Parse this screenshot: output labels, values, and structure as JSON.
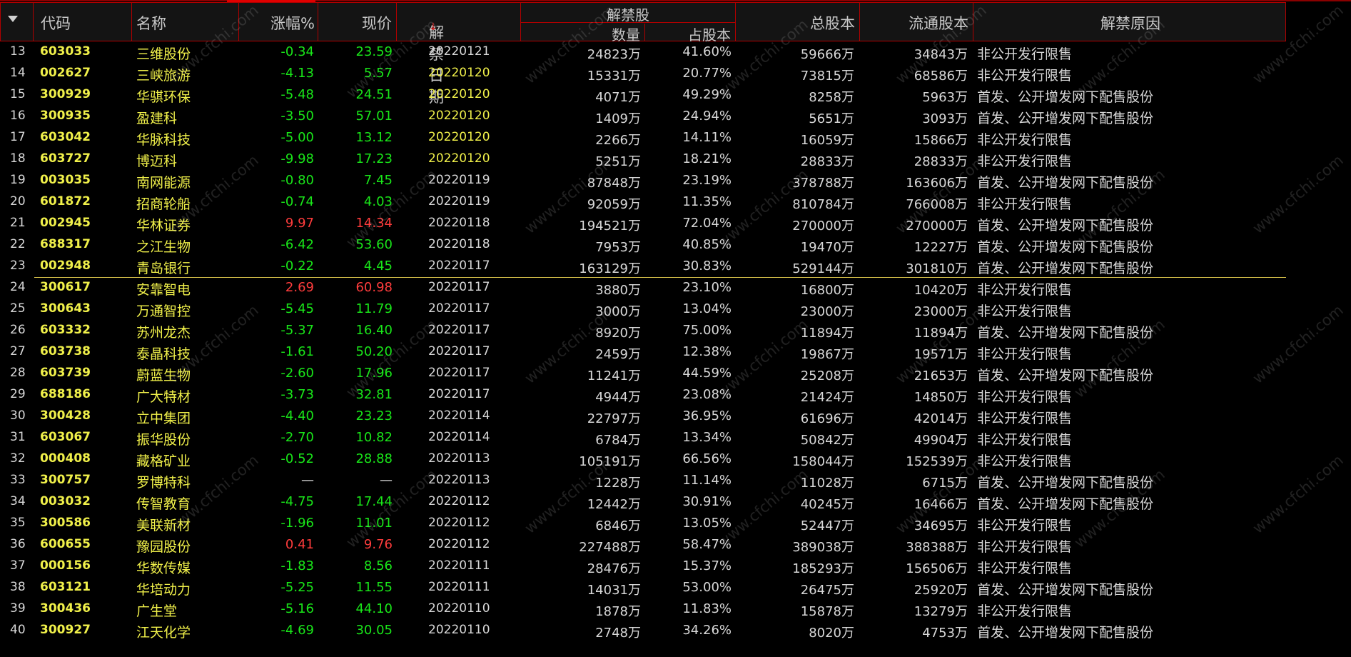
{
  "colors": {
    "up": "#ff3c3c",
    "down": "#19e619",
    "flat": "#d8d8d8",
    "yellow_date": "#f0f04a",
    "normal_date": "#d8d8d8"
  },
  "header": {
    "menu_icon": "triangle-down-icon",
    "code": "代码",
    "name": "名称",
    "change": "涨幅%",
    "price": "现价",
    "date": "解禁日期",
    "date_sort_icon": "sort-desc-arrow-icon",
    "date_sort_glyph": "↓",
    "unlock_group": "解禁股",
    "unlock_qty": "数量",
    "unlock_pct": "占股本",
    "total_shares": "总股本",
    "float_shares": "流通股本",
    "reason": "解禁原因"
  },
  "watermark": "www.cfchi.com",
  "rows": [
    {
      "idx": "13",
      "code": "603033",
      "name": "三维股份",
      "chg": "-0.34",
      "price": "23.59",
      "dir": "down",
      "date": "20220121",
      "date_hl": false,
      "qty": "24823万",
      "pct": "41.60%",
      "total": "59666万",
      "float": "34843万",
      "reason": "非公开发行限售"
    },
    {
      "idx": "14",
      "code": "002627",
      "name": "三峡旅游",
      "chg": "-4.13",
      "price": "5.57",
      "dir": "down",
      "date": "20220120",
      "date_hl": true,
      "qty": "15331万",
      "pct": "20.77%",
      "total": "73815万",
      "float": "68586万",
      "reason": "非公开发行限售"
    },
    {
      "idx": "15",
      "code": "300929",
      "name": "华骐环保",
      "chg": "-5.48",
      "price": "24.51",
      "dir": "down",
      "date": "20220120",
      "date_hl": true,
      "qty": "4071万",
      "pct": "49.29%",
      "total": "8258万",
      "float": "5963万",
      "reason": "首发、公开增发网下配售股份"
    },
    {
      "idx": "16",
      "code": "300935",
      "name": "盈建科",
      "chg": "-3.50",
      "price": "57.01",
      "dir": "down",
      "date": "20220120",
      "date_hl": true,
      "qty": "1409万",
      "pct": "24.94%",
      "total": "5651万",
      "float": "3093万",
      "reason": "首发、公开增发网下配售股份"
    },
    {
      "idx": "17",
      "code": "603042",
      "name": "华脉科技",
      "chg": "-5.00",
      "price": "13.12",
      "dir": "down",
      "date": "20220120",
      "date_hl": true,
      "qty": "2266万",
      "pct": "14.11%",
      "total": "16059万",
      "float": "15866万",
      "reason": "非公开发行限售"
    },
    {
      "idx": "18",
      "code": "603727",
      "name": "博迈科",
      "chg": "-9.98",
      "price": "17.23",
      "dir": "down",
      "date": "20220120",
      "date_hl": true,
      "qty": "5251万",
      "pct": "18.21%",
      "total": "28833万",
      "float": "28833万",
      "reason": "非公开发行限售"
    },
    {
      "idx": "19",
      "code": "003035",
      "name": "南网能源",
      "chg": "-0.80",
      "price": "7.45",
      "dir": "down",
      "date": "20220119",
      "date_hl": false,
      "qty": "87848万",
      "pct": "23.19%",
      "total": "378788万",
      "float": "163606万",
      "reason": "首发、公开增发网下配售股份"
    },
    {
      "idx": "20",
      "code": "601872",
      "name": "招商轮船",
      "chg": "-0.74",
      "price": "4.03",
      "dir": "down",
      "date": "20220119",
      "date_hl": false,
      "qty": "92059万",
      "pct": "11.35%",
      "total": "810784万",
      "float": "766008万",
      "reason": "非公开发行限售"
    },
    {
      "idx": "21",
      "code": "002945",
      "name": "华林证券",
      "chg": "9.97",
      "price": "14.34",
      "dir": "up",
      "date": "20220118",
      "date_hl": false,
      "qty": "194521万",
      "pct": "72.04%",
      "total": "270000万",
      "float": "270000万",
      "reason": "首发、公开增发网下配售股份"
    },
    {
      "idx": "22",
      "code": "688317",
      "name": "之江生物",
      "chg": "-6.42",
      "price": "53.60",
      "dir": "down",
      "date": "20220118",
      "date_hl": false,
      "qty": "7953万",
      "pct": "40.85%",
      "total": "19470万",
      "float": "12227万",
      "reason": "首发、公开增发网下配售股份"
    },
    {
      "idx": "23",
      "code": "002948",
      "name": "青岛银行",
      "chg": "-0.22",
      "price": "4.45",
      "dir": "down",
      "date": "20220117",
      "date_hl": false,
      "qty": "163129万",
      "pct": "30.83%",
      "total": "529144万",
      "float": "301810万",
      "reason": "首发、公开增发网下配售股份"
    },
    {
      "idx": "24",
      "code": "300617",
      "name": "安靠智电",
      "chg": "2.69",
      "price": "60.98",
      "dir": "up",
      "date": "20220117",
      "date_hl": false,
      "qty": "3880万",
      "pct": "23.10%",
      "total": "16800万",
      "float": "10420万",
      "reason": "非公开发行限售"
    },
    {
      "idx": "25",
      "code": "300643",
      "name": "万通智控",
      "chg": "-5.45",
      "price": "11.79",
      "dir": "down",
      "date": "20220117",
      "date_hl": false,
      "qty": "3000万",
      "pct": "13.04%",
      "total": "23000万",
      "float": "23000万",
      "reason": "非公开发行限售"
    },
    {
      "idx": "26",
      "code": "603332",
      "name": "苏州龙杰",
      "chg": "-5.37",
      "price": "16.40",
      "dir": "down",
      "date": "20220117",
      "date_hl": false,
      "qty": "8920万",
      "pct": "75.00%",
      "total": "11894万",
      "float": "11894万",
      "reason": "首发、公开增发网下配售股份"
    },
    {
      "idx": "27",
      "code": "603738",
      "name": "泰晶科技",
      "chg": "-1.61",
      "price": "50.20",
      "dir": "down",
      "date": "20220117",
      "date_hl": false,
      "qty": "2459万",
      "pct": "12.38%",
      "total": "19867万",
      "float": "19571万",
      "reason": "非公开发行限售"
    },
    {
      "idx": "28",
      "code": "603739",
      "name": "蔚蓝生物",
      "chg": "-2.60",
      "price": "17.96",
      "dir": "down",
      "date": "20220117",
      "date_hl": false,
      "qty": "11241万",
      "pct": "44.59%",
      "total": "25208万",
      "float": "21653万",
      "reason": "首发、公开增发网下配售股份"
    },
    {
      "idx": "29",
      "code": "688186",
      "name": "广大特材",
      "chg": "-3.73",
      "price": "32.81",
      "dir": "down",
      "date": "20220117",
      "date_hl": false,
      "qty": "4944万",
      "pct": "23.08%",
      "total": "21424万",
      "float": "14850万",
      "reason": "非公开发行限售"
    },
    {
      "idx": "30",
      "code": "300428",
      "name": "立中集团",
      "chg": "-4.40",
      "price": "23.23",
      "dir": "down",
      "date": "20220114",
      "date_hl": false,
      "qty": "22797万",
      "pct": "36.95%",
      "total": "61696万",
      "float": "42014万",
      "reason": "非公开发行限售"
    },
    {
      "idx": "31",
      "code": "603067",
      "name": "振华股份",
      "chg": "-2.70",
      "price": "10.82",
      "dir": "down",
      "date": "20220114",
      "date_hl": false,
      "qty": "6784万",
      "pct": "13.34%",
      "total": "50842万",
      "float": "49904万",
      "reason": "非公开发行限售"
    },
    {
      "idx": "32",
      "code": "000408",
      "name": "藏格矿业",
      "chg": "-0.52",
      "price": "28.88",
      "dir": "down",
      "date": "20220113",
      "date_hl": false,
      "qty": "105191万",
      "pct": "66.56%",
      "total": "158044万",
      "float": "152539万",
      "reason": "非公开发行限售"
    },
    {
      "idx": "33",
      "code": "300757",
      "name": "罗博特科",
      "chg": "—",
      "price": "—",
      "dir": "flat",
      "date": "20220113",
      "date_hl": false,
      "qty": "1228万",
      "pct": "11.14%",
      "total": "11028万",
      "float": "6715万",
      "reason": "首发、公开增发网下配售股份"
    },
    {
      "idx": "34",
      "code": "003032",
      "name": "传智教育",
      "chg": "-4.75",
      "price": "17.44",
      "dir": "down",
      "date": "20220112",
      "date_hl": false,
      "qty": "12442万",
      "pct": "30.91%",
      "total": "40245万",
      "float": "16466万",
      "reason": "首发、公开增发网下配售股份"
    },
    {
      "idx": "35",
      "code": "300586",
      "name": "美联新材",
      "chg": "-1.96",
      "price": "11.01",
      "dir": "down",
      "date": "20220112",
      "date_hl": false,
      "qty": "6846万",
      "pct": "13.05%",
      "total": "52447万",
      "float": "34695万",
      "reason": "非公开发行限售"
    },
    {
      "idx": "36",
      "code": "600655",
      "name": "豫园股份",
      "chg": "0.41",
      "price": "9.76",
      "dir": "up",
      "date": "20220112",
      "date_hl": false,
      "qty": "227488万",
      "pct": "58.47%",
      "total": "389038万",
      "float": "388388万",
      "reason": "非公开发行限售"
    },
    {
      "idx": "37",
      "code": "000156",
      "name": "华数传媒",
      "chg": "-1.83",
      "price": "8.56",
      "dir": "down",
      "date": "20220111",
      "date_hl": false,
      "qty": "28476万",
      "pct": "15.37%",
      "total": "185293万",
      "float": "156506万",
      "reason": "非公开发行限售"
    },
    {
      "idx": "38",
      "code": "603121",
      "name": "华培动力",
      "chg": "-5.25",
      "price": "11.55",
      "dir": "down",
      "date": "20220111",
      "date_hl": false,
      "qty": "14031万",
      "pct": "53.00%",
      "total": "26475万",
      "float": "25920万",
      "reason": "首发、公开增发网下配售股份"
    },
    {
      "idx": "39",
      "code": "300436",
      "name": "广生堂",
      "chg": "-5.16",
      "price": "44.10",
      "dir": "down",
      "date": "20220110",
      "date_hl": false,
      "qty": "1878万",
      "pct": "11.83%",
      "total": "15878万",
      "float": "13279万",
      "reason": "非公开发行限售"
    },
    {
      "idx": "40",
      "code": "300927",
      "name": "江天化学",
      "chg": "-4.69",
      "price": "30.05",
      "dir": "down",
      "date": "20220110",
      "date_hl": false,
      "qty": "2748万",
      "pct": "34.26%",
      "total": "8020万",
      "float": "4753万",
      "reason": "首发、公开增发网下配售股份"
    }
  ]
}
